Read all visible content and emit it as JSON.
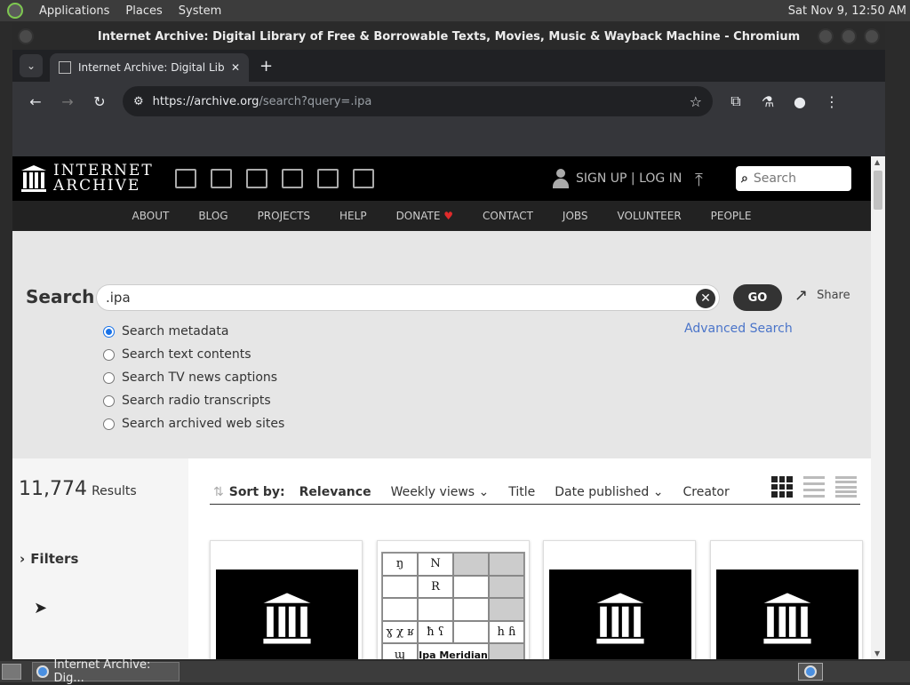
{
  "panel": {
    "menus": [
      "Applications",
      "Places",
      "System"
    ],
    "clock": "Sat Nov  9, 12:50 AM"
  },
  "window": {
    "title": "Internet Archive: Digital Library of Free & Borrowable Texts, Movies, Music & Wayback Machine - Chromium"
  },
  "browser": {
    "tab_title": "Internet Archive: Digital Libra",
    "url_host": "https://archive.org",
    "url_path": "/search?query=.ipa"
  },
  "ia": {
    "logo_line1": "INTERNET",
    "logo_line2": "ARCHIVE",
    "signup": "SIGN UP | LOG IN",
    "search_placeholder": "Search",
    "nav": [
      "ABOUT",
      "BLOG",
      "PROJECTS",
      "HELP",
      "DONATE",
      "CONTACT",
      "JOBS",
      "VOLUNTEER",
      "PEOPLE"
    ]
  },
  "search": {
    "label": "Search",
    "query": ".ipa",
    "go": "GO",
    "share": "Share",
    "advanced": "Advanced Search",
    "options": [
      {
        "label": "Search metadata",
        "checked": true
      },
      {
        "label": "Search text contents",
        "checked": false
      },
      {
        "label": "Search TV news captions",
        "checked": false
      },
      {
        "label": "Search radio transcripts",
        "checked": false
      },
      {
        "label": "Search archived web sites",
        "checked": false
      }
    ]
  },
  "results": {
    "count": "11,774",
    "count_label": "Results",
    "filters": "Filters",
    "sort_label": "Sort by:",
    "sort_items": [
      "Relevance",
      "Weekly views",
      "Title",
      "Date published",
      "Creator"
    ],
    "sort_active": "Relevance",
    "ipa_card": {
      "cells": [
        "ŋ",
        "N",
        "",
        "",
        "",
        "R",
        "",
        "",
        "ɣ χ ʁ",
        "ħ ʕ",
        "",
        "h ɦ",
        "ɰ",
        "Ipa Meridian",
        ""
      ]
    }
  },
  "taskbar": {
    "task_label": "Internet Archive: Dig..."
  }
}
